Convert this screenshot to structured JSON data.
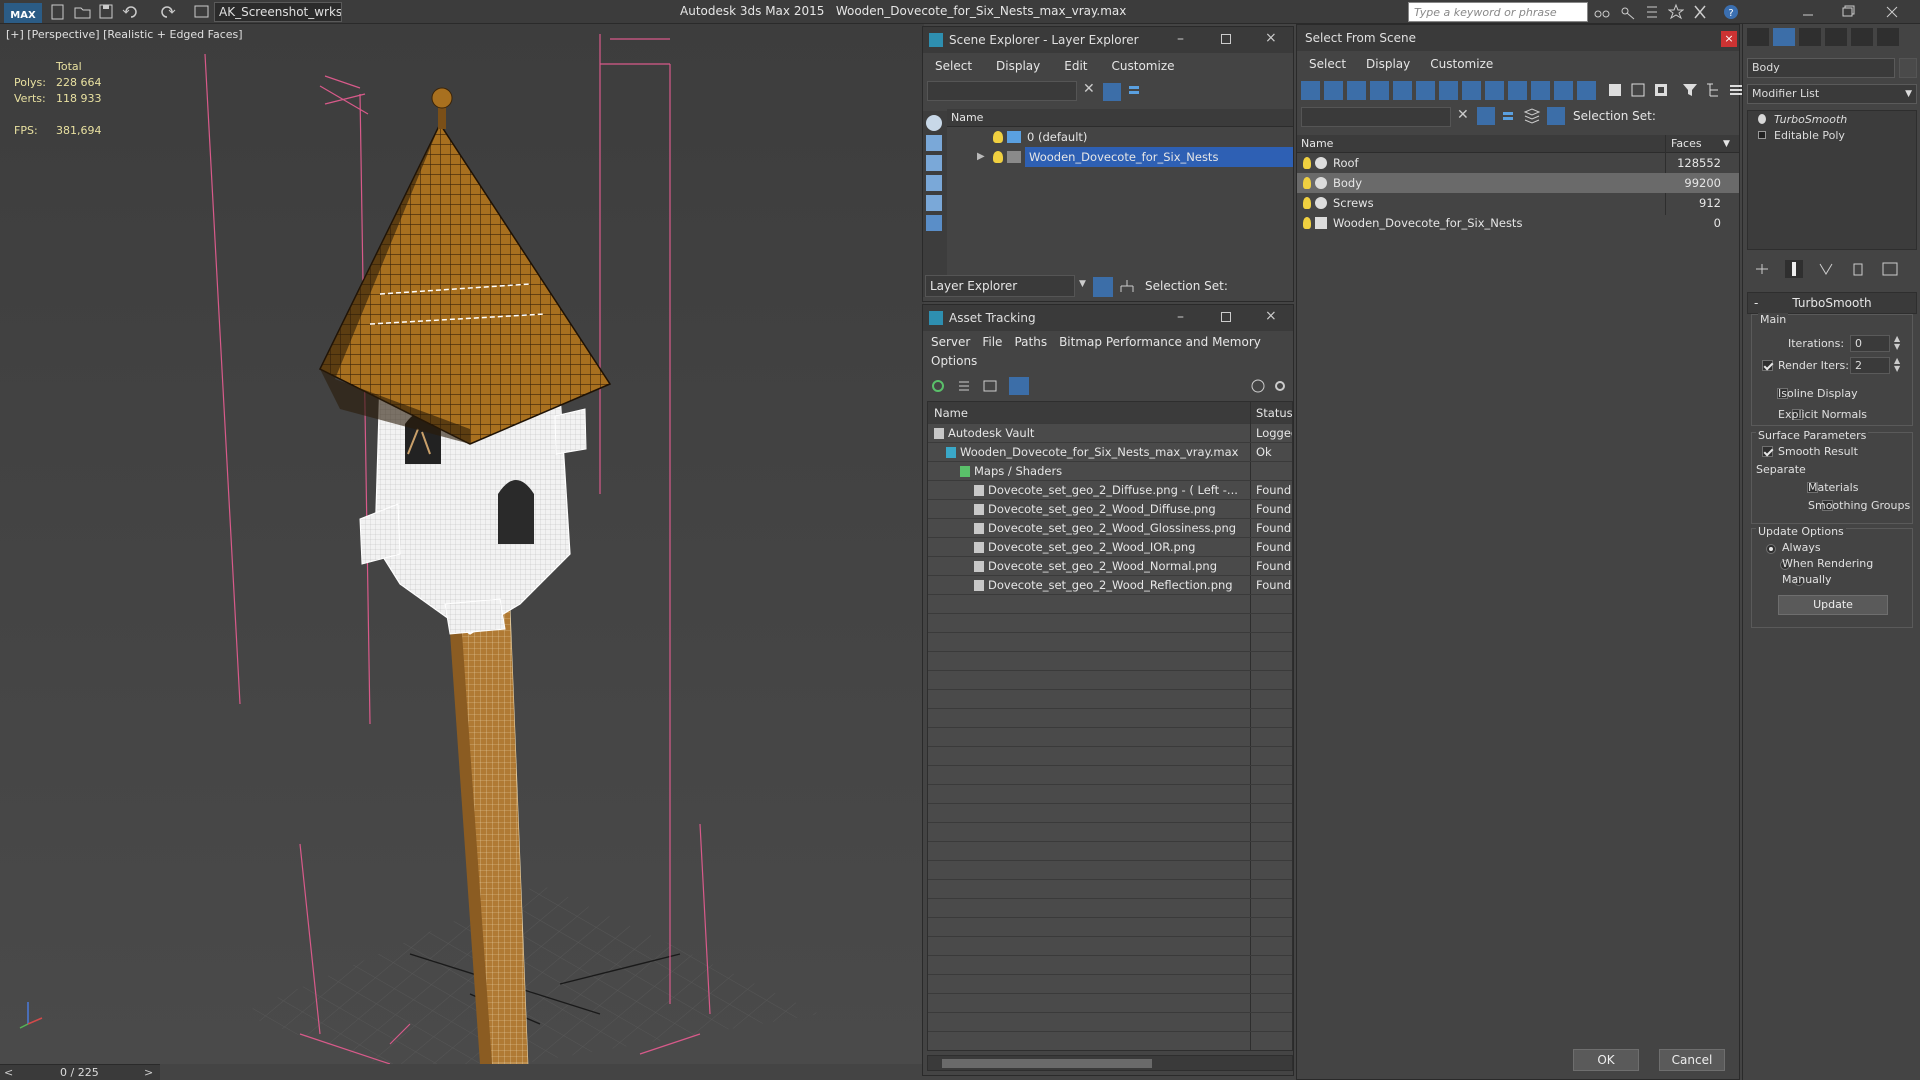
{
  "titlebar": {
    "app_label": "MAX",
    "workspace": "AK_Screenshot_wrksp",
    "app_name": "Autodesk 3ds Max  2015",
    "file_name": "Wooden_Dovecote_for_Six_Nests_max_vray.max",
    "search_placeholder": "Type a keyword or phrase"
  },
  "viewport": {
    "label": "[+] [Perspective] [Realistic + Edged Faces]",
    "stats": {
      "total_label": "Total",
      "polys_label": "Polys:",
      "polys_value": "228 664",
      "verts_label": "Verts:",
      "verts_value": "118 933",
      "fps_label": "FPS:",
      "fps_value": "381,694"
    },
    "timeline": "0 / 225"
  },
  "scene_explorer": {
    "title": "Scene Explorer - Layer Explorer",
    "menu": [
      "Select",
      "Display",
      "Edit",
      "Customize"
    ],
    "column": "Name",
    "rows": [
      {
        "label": "0 (default)",
        "selected": false
      },
      {
        "label": "Wooden_Dovecote_for_Six_Nests",
        "selected": true
      }
    ],
    "footer_label": "Layer Explorer",
    "selection_set": "Selection Set:"
  },
  "asset_tracking": {
    "title": "Asset Tracking",
    "menu": [
      "Server",
      "File",
      "Paths",
      "Bitmap Performance and Memory"
    ],
    "menu2": "Options",
    "col_name": "Name",
    "col_status": "Status",
    "rows": [
      {
        "name": "Autodesk Vault",
        "status": "Logged",
        "indent": 0
      },
      {
        "name": "Wooden_Dovecote_for_Six_Nests_max_vray.max",
        "status": "Ok",
        "indent": 1
      },
      {
        "name": "Maps / Shaders",
        "status": "",
        "indent": 2
      },
      {
        "name": "Dovecote_set_geo_2_Diffuse.png - ( Left -...",
        "status": "Found",
        "indent": 3
      },
      {
        "name": "Dovecote_set_geo_2_Wood_Diffuse.png",
        "status": "Found",
        "indent": 3
      },
      {
        "name": "Dovecote_set_geo_2_Wood_Glossiness.png",
        "status": "Found",
        "indent": 3
      },
      {
        "name": "Dovecote_set_geo_2_Wood_IOR.png",
        "status": "Found",
        "indent": 3
      },
      {
        "name": "Dovecote_set_geo_2_Wood_Normal.png",
        "status": "Found",
        "indent": 3
      },
      {
        "name": "Dovecote_set_geo_2_Wood_Reflection.png",
        "status": "Found",
        "indent": 3
      }
    ]
  },
  "select_from_scene": {
    "title": "Select From Scene",
    "menu": [
      "Select",
      "Display",
      "Customize"
    ],
    "selection_set": "Selection Set:",
    "col_name": "Name",
    "col_faces": "Faces",
    "rows": [
      {
        "name": "Roof",
        "faces": "128552",
        "selected": false
      },
      {
        "name": "Body",
        "faces": "99200",
        "selected": true
      },
      {
        "name": "Screws",
        "faces": "912",
        "selected": false
      },
      {
        "name": "Wooden_Dovecote_for_Six_Nests",
        "faces": "0",
        "selected": false
      }
    ],
    "ok": "OK",
    "cancel": "Cancel"
  },
  "command_panel": {
    "object_name": "Body",
    "modifier_list": "Modifier List",
    "stack": [
      "TurboSmooth",
      "Editable Poly"
    ],
    "rollout_title": "TurboSmooth",
    "main_label": "Main",
    "iterations_label": "Iterations:",
    "iterations_value": "0",
    "render_iters_label": "Render Iters:",
    "render_iters_value": "2",
    "isoline": "Isoline Display",
    "explicit_normals": "Explicit Normals",
    "surface_params": "Surface Parameters",
    "smooth_result": "Smooth Result",
    "separate": "Separate",
    "materials": "Materials",
    "smoothing_groups": "Smoothing Groups",
    "update_options": "Update Options",
    "always": "Always",
    "when_rendering": "When Rendering",
    "manually": "Manually",
    "update_btn": "Update"
  }
}
